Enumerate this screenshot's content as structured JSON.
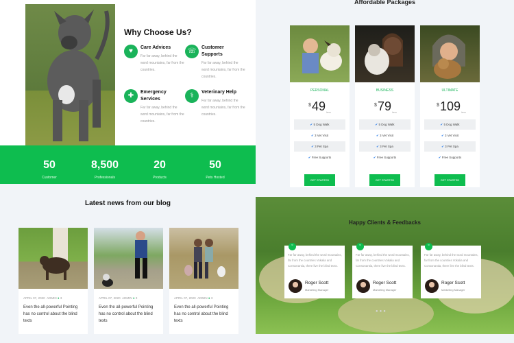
{
  "why": {
    "title": "Why Choose Us?",
    "features": [
      {
        "title": "Care Advices",
        "desc": "Far far away, behind the word mountains, far from the countries.",
        "icon": "pet-care-icon"
      },
      {
        "title": "Customer Supports",
        "desc": "Far far away, behind the word mountains, far from the countries.",
        "icon": "support-icon"
      },
      {
        "title": "Emergency Services",
        "desc": "Far far away, behind the word mountains, far from the countries.",
        "icon": "emergency-icon"
      },
      {
        "title": "Veterinary Help",
        "desc": "Far far away, behind the word mountains, far from the countries.",
        "icon": "veterinary-icon"
      }
    ]
  },
  "stats": [
    {
      "value": "50",
      "label": "Customer"
    },
    {
      "value": "8,500",
      "label": "Professionals"
    },
    {
      "value": "20",
      "label": "Products"
    },
    {
      "value": "50",
      "label": "Pets Hosted"
    }
  ],
  "packages": {
    "title": "Affordable Packages",
    "currency": "$",
    "per": "/mo",
    "button": "GET STARTED",
    "plans": [
      {
        "name": "PERSONAL",
        "price": "49",
        "features": [
          "5 Dog Walk",
          "3 Vet Visit",
          "3 Pet Spa",
          "Free Supports"
        ]
      },
      {
        "name": "BUSINESS",
        "price": "79",
        "features": [
          "5 Dog Walk",
          "3 Vet Visit",
          "3 Pet Spa",
          "Free Supports"
        ]
      },
      {
        "name": "ULTIMATE",
        "price": "109",
        "features": [
          "5 Dog Walk",
          "3 Vet Visit",
          "3 Pet Spa",
          "Free Supports"
        ]
      }
    ]
  },
  "blog": {
    "title": "Latest news from our blog",
    "posts": [
      {
        "date": "APRIL 07, 2020",
        "author": "ADMIN",
        "comments": "3",
        "text": "Even the all-powerful Pointing has no control about the blind texts"
      },
      {
        "date": "APRIL 07, 2020",
        "author": "ADMIN",
        "comments": "3",
        "text": "Even the all-powerful Pointing has no control about the blind texts"
      },
      {
        "date": "APRIL 07, 2020",
        "author": "ADMIN",
        "comments": "3",
        "text": "Even the all-powerful Pointing has no control about the blind texts"
      }
    ]
  },
  "testimonials": {
    "title": "Happy Clients & Feedbacks",
    "items": [
      {
        "text": "Far far away, behind the word mountains, far from the countries Vokalia and Consonantia, there live the blind texts.",
        "name": "Roger Scott",
        "role": "Marketing Manager"
      },
      {
        "text": "Far far away, behind the word mountains, far from the countries Vokalia and Consonantia, there live the blind texts.",
        "name": "Roger Scott",
        "role": "Marketing Manager"
      },
      {
        "text": "Far far away, behind the word mountains, far from the countries Vokalia and Consonantia, there live the blind texts.",
        "name": "Roger Scott",
        "role": "Marketing Manager"
      }
    ]
  },
  "colors": {
    "accent": "#0ebd4f",
    "tick": "#1a73e8"
  }
}
